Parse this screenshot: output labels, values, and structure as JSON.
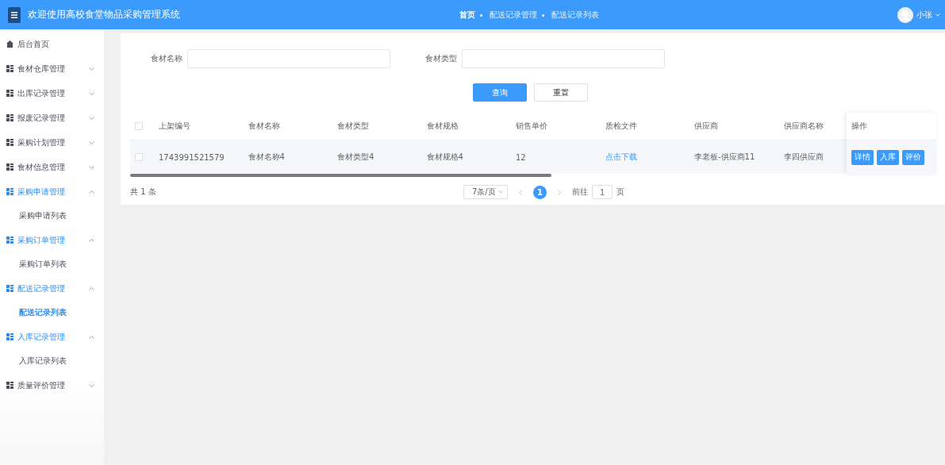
{
  "header": {
    "title": "欢迎使用高校食堂物品采购管理系统",
    "breadcrumb": [
      {
        "label": "首页",
        "selected": true
      },
      {
        "label": "配送记录管理",
        "selected": false
      },
      {
        "label": "配送记录列表",
        "selected": false
      }
    ],
    "user": "小张"
  },
  "sidebar": {
    "items": [
      {
        "label": "后台首页",
        "kind": "home"
      },
      {
        "label": "食材仓库管理",
        "kind": "group",
        "expanded": false,
        "selected": false
      },
      {
        "label": "出库记录管理",
        "kind": "group",
        "expanded": false,
        "selected": false
      },
      {
        "label": "报废记录管理",
        "kind": "group",
        "expanded": false,
        "selected": false
      },
      {
        "label": "采购计划管理",
        "kind": "group",
        "expanded": false,
        "selected": false
      },
      {
        "label": "食材信息管理",
        "kind": "group",
        "expanded": false,
        "selected": false
      },
      {
        "label": "采购申请管理",
        "kind": "group",
        "expanded": true,
        "selected": true,
        "children": [
          {
            "label": "采购申请列表",
            "selected": false
          }
        ]
      },
      {
        "label": "采购订单管理",
        "kind": "group",
        "expanded": true,
        "selected": true,
        "children": [
          {
            "label": "采购订单列表",
            "selected": false
          }
        ]
      },
      {
        "label": "配送记录管理",
        "kind": "group",
        "expanded": true,
        "selected": true,
        "children": [
          {
            "label": "配送记录列表",
            "selected": true
          }
        ]
      },
      {
        "label": "入库记录管理",
        "kind": "group",
        "expanded": true,
        "selected": true,
        "children": [
          {
            "label": "入库记录列表",
            "selected": false
          }
        ]
      },
      {
        "label": "质量评价管理",
        "kind": "group",
        "expanded": false,
        "selected": false
      }
    ]
  },
  "filters": [
    {
      "label": "食材名称"
    },
    {
      "label": "食材类型"
    }
  ],
  "buttons": [
    {
      "label": "查询",
      "kind": "primary"
    },
    {
      "label": "重置",
      "kind": "plain"
    }
  ],
  "table": {
    "select_all": {
      "checked": false
    },
    "columns": [
      "上架编号",
      "食材名称",
      "食材类型",
      "食材规格",
      "销售单价",
      "质检文件",
      "供应商",
      "供应商名称",
      "操作"
    ],
    "rows": [
      {
        "checked": false,
        "cells": [
          "1743991521579",
          "食材名称4",
          "食材类型4",
          "食材规格4",
          "12",
          "点击下载",
          "李老板-供应商11",
          "李四供应商"
        ],
        "actions": [
          "详情",
          "入库",
          "评价"
        ]
      }
    ]
  },
  "pagination": {
    "total": "共 1 条",
    "page_size": "7条/页",
    "pages": [
      {
        "label": "1",
        "selected": true
      }
    ],
    "goto_label": "前往",
    "goto_value": "1",
    "goto_suffix": "页"
  }
}
